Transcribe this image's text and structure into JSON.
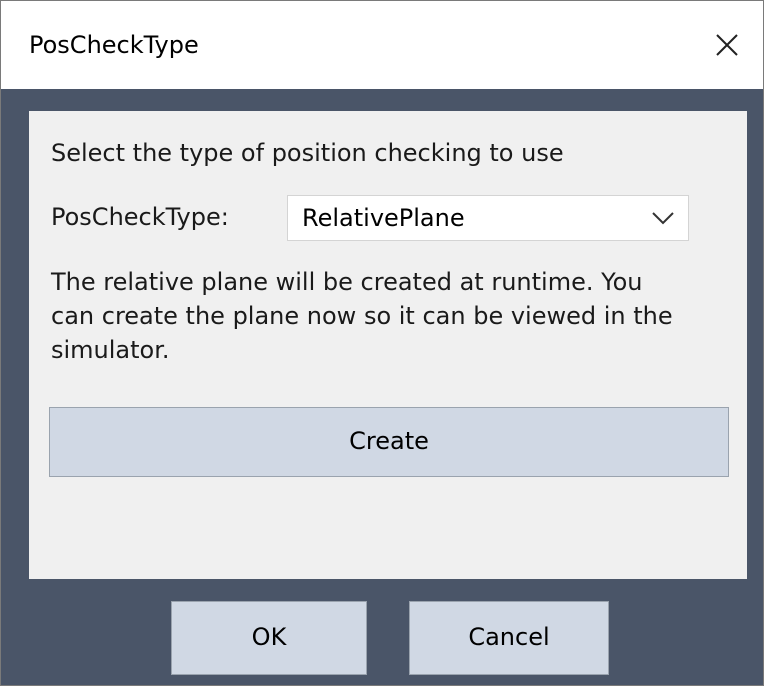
{
  "window": {
    "title": "PosCheckType",
    "close_icon": "close-icon"
  },
  "panel": {
    "prompt": "Select the type of position checking to use",
    "select_label": "PosCheckType:",
    "select_value": "RelativePlane",
    "select_icon": "chevron-down-icon",
    "info_lines": [
      "The relative plane will be created at runtime.  You",
      "can create the plane now so it can be viewed in the",
      "simulator."
    ],
    "create_label": "Create"
  },
  "footer": {
    "ok_label": "OK",
    "cancel_label": "Cancel"
  },
  "colors": {
    "frame": "#4a5568",
    "panel_bg": "#f0f0f0",
    "button_bg": "#d0d8e4",
    "titlebar_bg": "#ffffff"
  }
}
